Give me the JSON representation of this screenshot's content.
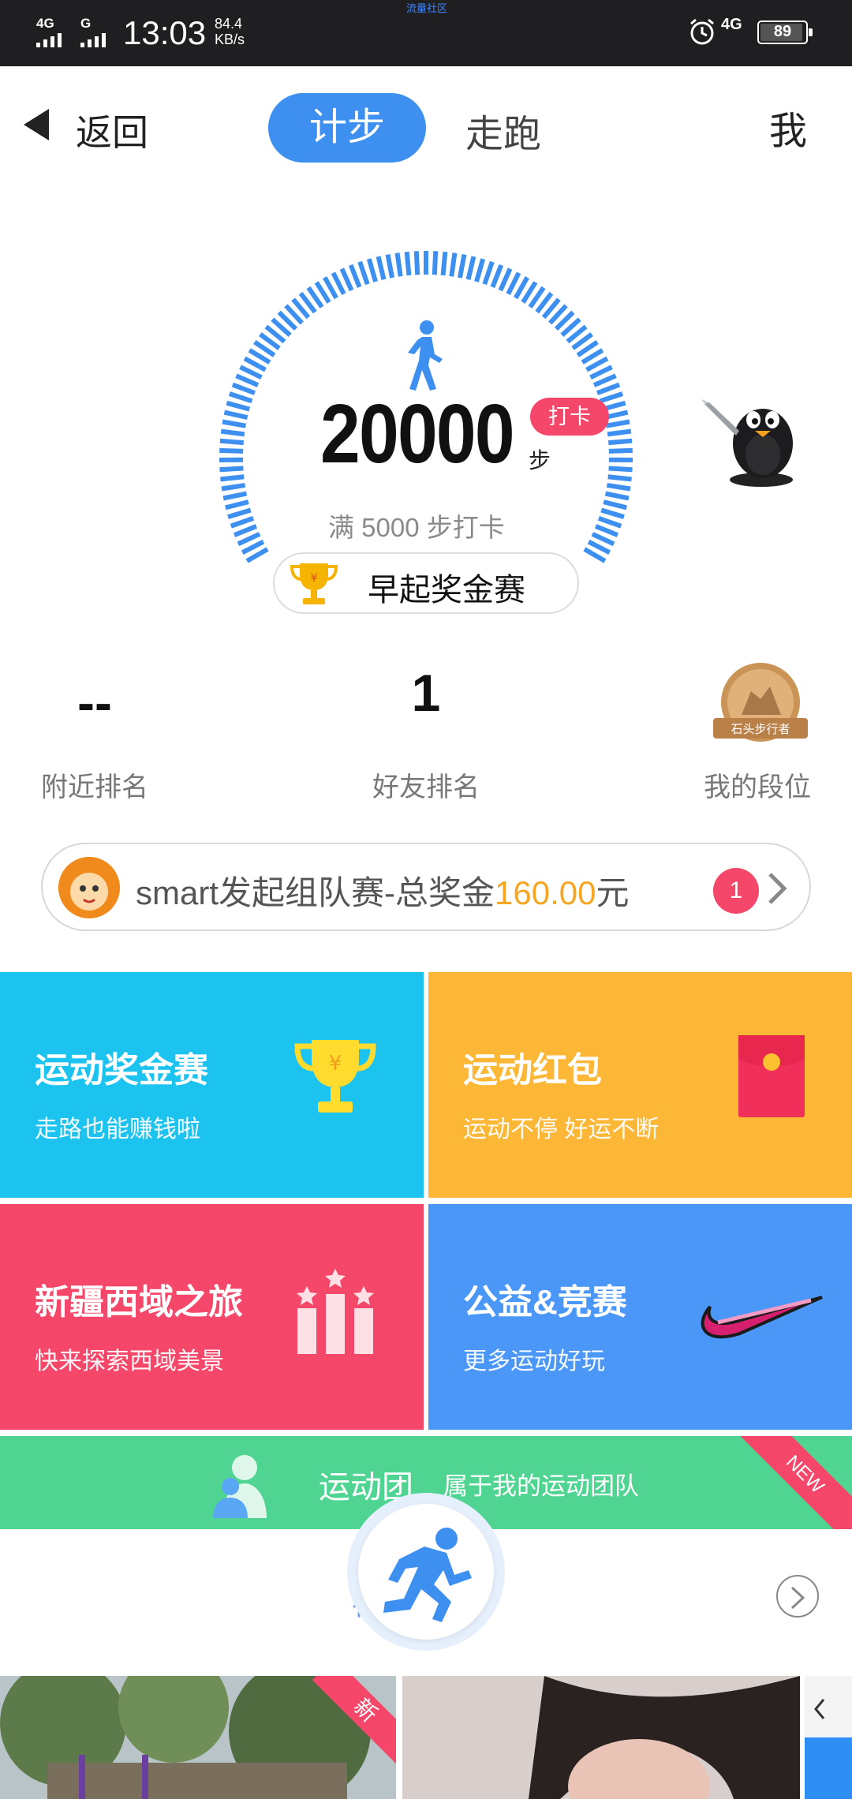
{
  "status_bar": {
    "carrier_tag": "流量社区",
    "signal1_label": "4G",
    "signal2_label": "G",
    "time": "13:03",
    "net_speed_value": "84.4",
    "net_speed_unit": "KB/s",
    "network": "4G",
    "battery": 89
  },
  "nav": {
    "back_label": "返回",
    "tabs": [
      {
        "label": "计步",
        "active": true
      },
      {
        "label": "走跑",
        "active": false
      }
    ],
    "me_label": "我"
  },
  "gauge": {
    "steps": "20000",
    "unit": "步",
    "checkin_label": "打卡",
    "target_text": "满 5000 步打卡",
    "race_label": "早起奖金赛",
    "color": "#3d8ff0"
  },
  "ranks": [
    {
      "value": "--",
      "label": "附近排名"
    },
    {
      "value": "1",
      "label": "好友排名"
    },
    {
      "value": "",
      "label": "我的段位"
    }
  ],
  "level_badge_text": "石头步行者",
  "team_race": {
    "text_prefix": "smart发起组队赛-总奖金",
    "amount": "160.00",
    "text_suffix": "元",
    "count": "1"
  },
  "tiles": [
    {
      "title": "运动奖金赛",
      "subtitle": "走路也能赚钱啦",
      "color": "#1cc3ef"
    },
    {
      "title": "运动红包",
      "subtitle": "运动不停 好运不断",
      "color": "#fbb735"
    },
    {
      "title": "新疆西域之旅",
      "subtitle": "快来探索西域美景",
      "color": "#f4476a"
    },
    {
      "title": "公益&竞赛",
      "subtitle": "更多运动好玩",
      "color": "#4a97f7"
    }
  ],
  "team_strip": {
    "title": "运动团",
    "subtitle": "属于我的运动团队",
    "badge": "NEW",
    "color": "#4fd492"
  },
  "section_fragment": "视",
  "cards": [
    {
      "tag": "新"
    }
  ],
  "icons": {
    "back": "back-arrow-icon",
    "walker": "walker-icon",
    "trophy": "trophy-icon",
    "red_packet": "red-envelope-icon",
    "podium": "podium-icon",
    "swoosh": "swoosh-icon",
    "run": "runner-icon",
    "chevron": "chevron-right-icon"
  }
}
